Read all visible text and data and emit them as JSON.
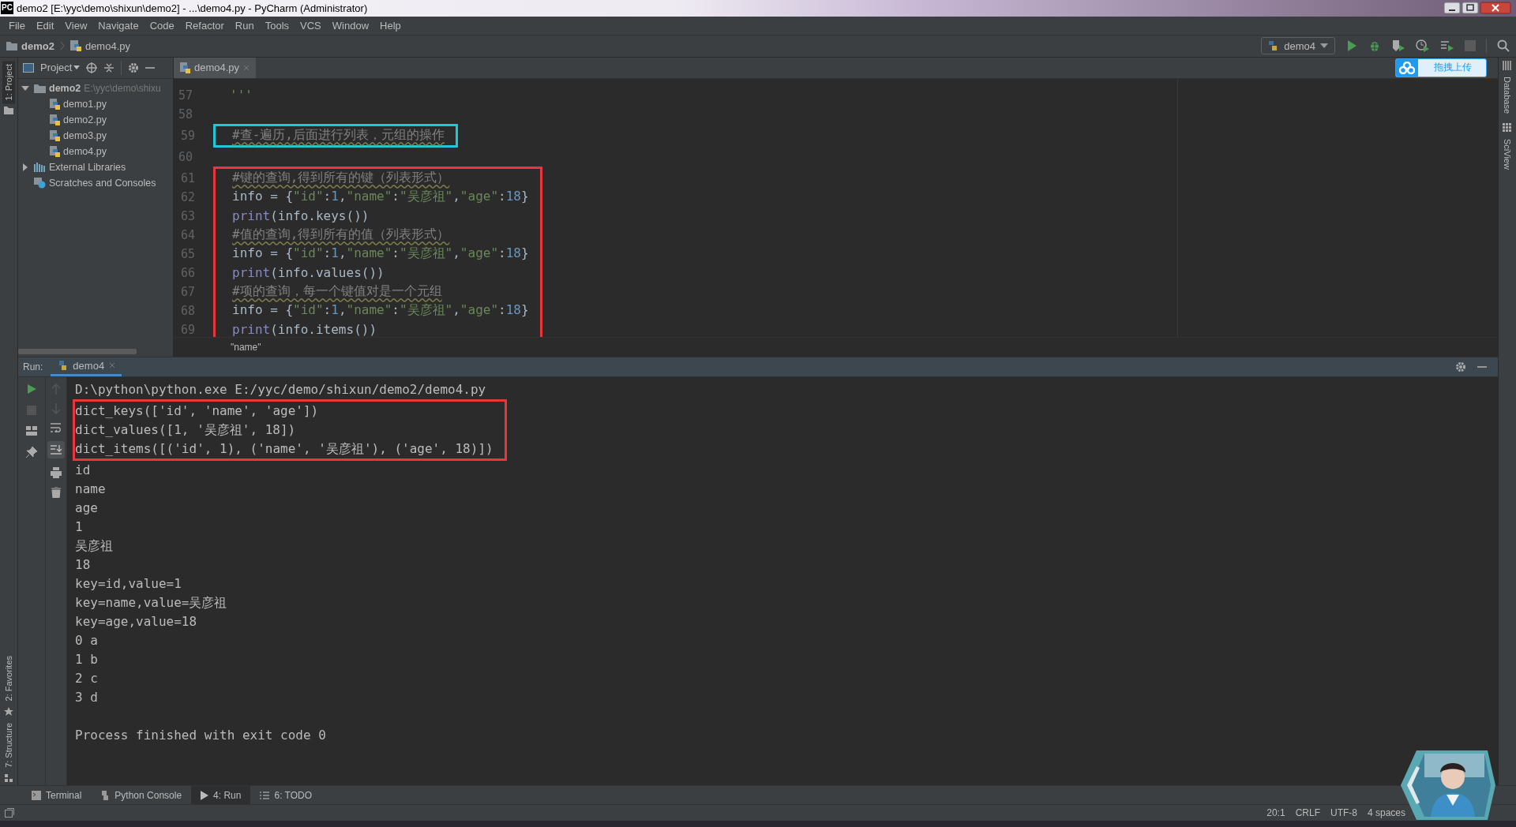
{
  "window": {
    "logo_text": "PC",
    "title": "demo2 [E:\\yyc\\demo\\shixun\\demo2] - ...\\demo4.py - PyCharm (Administrator)"
  },
  "menu": [
    "File",
    "Edit",
    "View",
    "Navigate",
    "Code",
    "Refactor",
    "Run",
    "Tools",
    "VCS",
    "Window",
    "Help"
  ],
  "breadcrumb": [
    "demo2",
    "demo4.py"
  ],
  "run_config": "demo4",
  "upload_button": "拖拽上传",
  "left_strip": {
    "top": [
      {
        "label": "1: Project",
        "selected": true
      }
    ],
    "bottom": [
      {
        "label": "2: Favorites",
        "selected": false
      },
      {
        "label": "7: Structure",
        "selected": false
      }
    ]
  },
  "right_strip": [
    "Database",
    "SciView"
  ],
  "project_panel": {
    "title": "Project",
    "tree": [
      {
        "label": "demo2",
        "path": "E:\\yyc\\demo\\shixu",
        "kind": "folder",
        "expanded": true,
        "children": [
          {
            "label": "demo1.py",
            "kind": "python"
          },
          {
            "label": "demo2.py",
            "kind": "python"
          },
          {
            "label": "demo3.py",
            "kind": "python"
          },
          {
            "label": "demo4.py",
            "kind": "python"
          }
        ]
      },
      {
        "label": "External Libraries",
        "kind": "library",
        "expanded": false
      },
      {
        "label": "Scratches and Consoles",
        "kind": "scratch"
      }
    ]
  },
  "editor": {
    "tab": {
      "label": "demo4.py",
      "selected": true
    },
    "blocks": [
      {
        "lines": [
          {
            "number": "57",
            "tokens": [
              {
                "kind": "string",
                "text": "'''"
              }
            ]
          },
          {
            "number": "58"
          }
        ]
      },
      {
        "color": "#1ec8d6",
        "lines": [
          {
            "number": "59",
            "tokens": [
              {
                "kind": "comment",
                "text": "#查-遍历,后面进行列表，元组的操作"
              }
            ]
          }
        ]
      },
      {
        "lines": [
          {
            "number": "60"
          }
        ]
      },
      {
        "color": "#e8363c",
        "lines": [
          {
            "number": "61",
            "tokens": [
              {
                "kind": "comment",
                "text": "#键的查询,得到所有的键（列表形式）"
              }
            ]
          },
          {
            "number": "62",
            "tokens": [
              {
                "kind": "plain",
                "text": "info = {"
              },
              {
                "kind": "string",
                "text": "\"id\""
              },
              {
                "kind": "plain",
                "text": ":"
              },
              {
                "kind": "number",
                "text": "1"
              },
              {
                "kind": "plain",
                "text": ","
              },
              {
                "kind": "string",
                "text": "\"name\""
              },
              {
                "kind": "plain",
                "text": ":"
              },
              {
                "kind": "string",
                "text": "\"吴彦祖\""
              },
              {
                "kind": "plain",
                "text": ","
              },
              {
                "kind": "string",
                "text": "\"age\""
              },
              {
                "kind": "plain",
                "text": ":"
              },
              {
                "kind": "number",
                "text": "18"
              },
              {
                "kind": "plain",
                "text": "}"
              }
            ]
          },
          {
            "number": "63",
            "tokens": [
              {
                "kind": "builtin",
                "text": "print"
              },
              {
                "kind": "plain",
                "text": "(info.keys())"
              }
            ]
          },
          {
            "number": "64",
            "tokens": [
              {
                "kind": "comment",
                "text": "#值的查询,得到所有的值（列表形式）"
              }
            ]
          },
          {
            "number": "65",
            "tokens": [
              {
                "kind": "plain",
                "text": "info = {"
              },
              {
                "kind": "string",
                "text": "\"id\""
              },
              {
                "kind": "plain",
                "text": ":"
              },
              {
                "kind": "number",
                "text": "1"
              },
              {
                "kind": "plain",
                "text": ","
              },
              {
                "kind": "string",
                "text": "\"name\""
              },
              {
                "kind": "plain",
                "text": ":"
              },
              {
                "kind": "string",
                "text": "\"吴彦祖\""
              },
              {
                "kind": "plain",
                "text": ","
              },
              {
                "kind": "string",
                "text": "\"age\""
              },
              {
                "kind": "plain",
                "text": ":"
              },
              {
                "kind": "number",
                "text": "18"
              },
              {
                "kind": "plain",
                "text": "}"
              }
            ]
          },
          {
            "number": "66",
            "tokens": [
              {
                "kind": "builtin",
                "text": "print"
              },
              {
                "kind": "plain",
                "text": "(info.values())"
              }
            ]
          },
          {
            "number": "67",
            "tokens": [
              {
                "kind": "comment",
                "text": "#项的查询，每一个键值对是一个元组"
              }
            ]
          },
          {
            "number": "68",
            "tokens": [
              {
                "kind": "plain",
                "text": "info = {"
              },
              {
                "kind": "string",
                "text": "\"id\""
              },
              {
                "kind": "plain",
                "text": ":"
              },
              {
                "kind": "number",
                "text": "1"
              },
              {
                "kind": "plain",
                "text": ","
              },
              {
                "kind": "string",
                "text": "\"name\""
              },
              {
                "kind": "plain",
                "text": ":"
              },
              {
                "kind": "string",
                "text": "\"吴彦祖\""
              },
              {
                "kind": "plain",
                "text": ","
              },
              {
                "kind": "string",
                "text": "\"age\""
              },
              {
                "kind": "plain",
                "text": ":"
              },
              {
                "kind": "number",
                "text": "18"
              },
              {
                "kind": "plain",
                "text": "}"
              }
            ]
          },
          {
            "number": "69",
            "tokens": [
              {
                "kind": "builtin",
                "text": "print"
              },
              {
                "kind": "plain",
                "text": "(info.items())"
              }
            ]
          }
        ]
      }
    ],
    "breadcrumb": "\"name\""
  },
  "run_panel": {
    "label": "Run:",
    "tab": {
      "label": "demo4",
      "selected": true
    },
    "blocks": [
      {
        "lines": [
          "D:\\python\\python.exe E:/yyc/demo/shixun/demo2/demo4.py"
        ]
      },
      {
        "color": "#e8363c",
        "lines": [
          "dict_keys(['id', 'name', 'age'])",
          "dict_values([1, '吴彦祖', 18])",
          "dict_items([('id', 1), ('name', '吴彦祖'), ('age', 18)])"
        ]
      },
      {
        "lines": [
          "id",
          "name",
          "age",
          "1",
          "吴彦祖",
          "18",
          "key=id,value=1",
          "key=name,value=吴彦祖",
          "key=age,value=18",
          "0 a",
          "1 b",
          "2 c",
          "3 d"
        ]
      }
    ],
    "exit_message": "Process finished with exit code 0"
  },
  "tool_tabs": [
    {
      "label": "Terminal",
      "kind": "terminal",
      "selected": false
    },
    {
      "label": "Python Console",
      "kind": "python",
      "selected": false
    },
    {
      "label": "4: Run",
      "kind": "run",
      "selected": true
    },
    {
      "label": "6: TODO",
      "kind": "todo",
      "selected": false
    }
  ],
  "status_bar": [
    "20:1",
    "CRLF",
    "UTF-8",
    "4 spaces"
  ]
}
